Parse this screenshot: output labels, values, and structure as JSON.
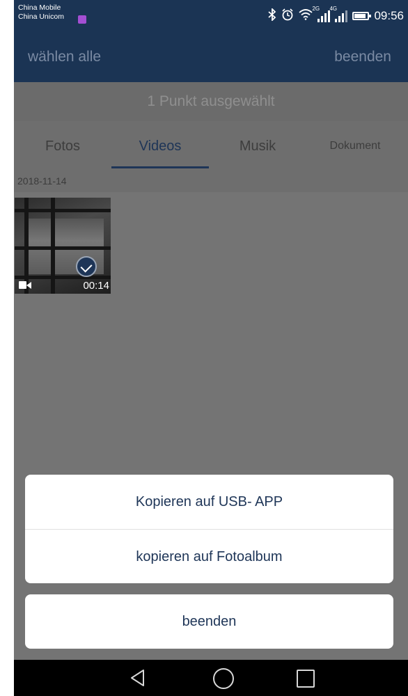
{
  "status_bar": {
    "carrier_1": "China Mobile",
    "carrier_2": "China Unicom",
    "net_2g": "2G",
    "net_4g": "4G",
    "time": "09:56",
    "icons": [
      "bluetooth-icon",
      "alarm-icon",
      "wifi-icon",
      "signal-2g-icon",
      "signal-4g-icon",
      "battery-icon"
    ]
  },
  "header": {
    "select_all": "wählen alle",
    "finish": "beenden"
  },
  "selection": {
    "text": "1 Punkt ausgewählt"
  },
  "tabs": [
    {
      "label": "Fotos",
      "active": false
    },
    {
      "label": "Videos",
      "active": true
    },
    {
      "label": "Musik",
      "active": false
    },
    {
      "label": "Dokument",
      "active": false
    }
  ],
  "content": {
    "date": "2018-11-14",
    "items": [
      {
        "type": "video",
        "duration": "00:14",
        "selected": true
      }
    ]
  },
  "action_sheet": {
    "copy_usb": "Kopieren auf USB- APP",
    "copy_album": "kopieren auf Fotoalbum",
    "cancel": "beenden"
  },
  "colors": {
    "primary": "#1b3454",
    "accent_text": "#1e3557",
    "overlay": "#747474"
  }
}
